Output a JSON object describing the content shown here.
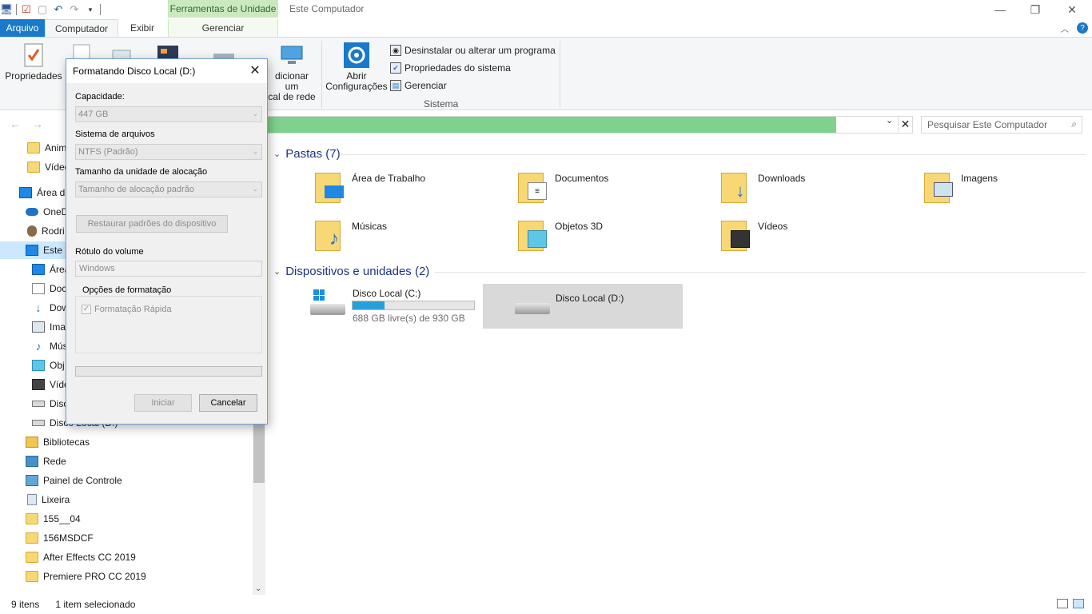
{
  "titlebar": {
    "context_tab": "Ferramentas de Unidade",
    "window_title": "Este Computador"
  },
  "tabs": {
    "file": "Arquivo",
    "computer": "Computador",
    "view": "Exibir",
    "manage": "Gerenciar"
  },
  "ribbon": {
    "properties": "Propriedades",
    "add_network_line1": "dicionar um",
    "add_network_line2": "cal de rede",
    "open_settings_line1": "Abrir",
    "open_settings_line2": "Configurações",
    "uninstall": "Desinstalar ou alterar um programa",
    "system_properties": "Propriedades do sistema",
    "manage": "Gerenciar",
    "system_group": "Sistema"
  },
  "search": {
    "placeholder": "Pesquisar Este Computador"
  },
  "nav": {
    "items": [
      {
        "label": "Anim"
      },
      {
        "label": "Vídeo"
      },
      {
        "label": "Área de"
      },
      {
        "label": "OneD"
      },
      {
        "label": "Rodri"
      },
      {
        "label": "Este C"
      },
      {
        "label": "Área"
      },
      {
        "label": "Doc"
      },
      {
        "label": "Dow"
      },
      {
        "label": "Ima"
      },
      {
        "label": "Mús"
      },
      {
        "label": "Obj"
      },
      {
        "label": "Víde"
      },
      {
        "label": "Disc"
      },
      {
        "label": "Disco Local (D:)"
      },
      {
        "label": "Bibliotecas"
      },
      {
        "label": "Rede"
      },
      {
        "label": "Painel de Controle"
      },
      {
        "label": "Lixeira"
      },
      {
        "label": "155__04"
      },
      {
        "label": "156MSDCF"
      },
      {
        "label": "After Effects CC 2019"
      },
      {
        "label": "Premiere PRO CC 2019"
      }
    ]
  },
  "main": {
    "folders_header": "Pastas (7)",
    "folders": [
      {
        "label": "Área de Trabalho",
        "icon": "desktop-icon"
      },
      {
        "label": "Documentos",
        "icon": "document-icon"
      },
      {
        "label": "Downloads",
        "icon": "download-arrow-icon"
      },
      {
        "label": "Imagens",
        "icon": "picture-icon"
      },
      {
        "label": "Músicas",
        "icon": "music-note-icon"
      },
      {
        "label": "Objetos 3D",
        "icon": "cube-icon"
      },
      {
        "label": "Vídeos",
        "icon": "film-icon"
      }
    ],
    "devices_header": "Dispositivos e unidades (2)",
    "drives": [
      {
        "label": "Disco Local (C:)",
        "free": "688 GB livre(s) de 930 GB",
        "used_fraction": 0.26
      },
      {
        "label": "Disco Local (D:)"
      }
    ]
  },
  "status": {
    "count": "9 itens",
    "selected": "1 item selecionado"
  },
  "dialog": {
    "title": "Formatando Disco Local (D:)",
    "capacity_label": "Capacidade:",
    "capacity_value": "447 GB",
    "fs_label": "Sistema de arquivos",
    "fs_value": "NTFS (Padrão)",
    "alloc_label": "Tamanho da unidade de alocação",
    "alloc_value": "Tamanho de alocação padrão",
    "restore_button": "Restaurar padrões do dispositivo",
    "volume_label": "Rótulo do volume",
    "volume_value": "Windows",
    "options_label": "Opções de formatação",
    "quick_format": "Formatação Rápida",
    "start_button": "Iniciar",
    "cancel_button": "Cancelar"
  },
  "colors": {
    "accent": "#1979ca",
    "address_progress": "#7fd18d",
    "drive_bar": "#26a0da",
    "selection": "#cce8ff"
  }
}
